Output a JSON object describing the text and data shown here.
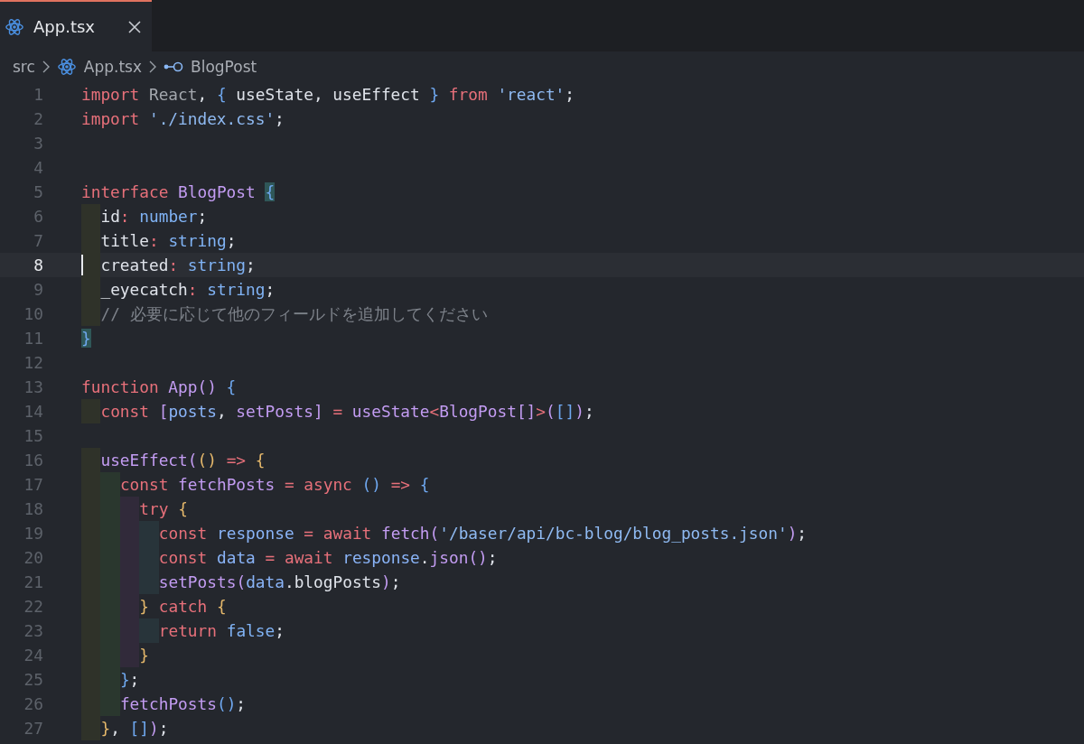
{
  "tabs": [
    {
      "label": "App.tsx",
      "selected": true
    }
  ],
  "breadcrumb": [
    {
      "kind": "folder",
      "label": "src"
    },
    {
      "kind": "file",
      "label": "App.tsx"
    },
    {
      "kind": "symbol",
      "label": "BlogPost"
    }
  ],
  "lines": [
    {
      "number": "1",
      "current": false,
      "tokens": [
        {
          "kind": "kw",
          "text": "import "
        },
        {
          "kind": "dim",
          "text": "React"
        },
        {
          "kind": "id",
          "text": ", "
        },
        {
          "kind": "b1",
          "text": "{ "
        },
        {
          "kind": "id",
          "text": "useState, useEffect "
        },
        {
          "kind": "b1",
          "text": "} "
        },
        {
          "kind": "kw",
          "text": "from "
        },
        {
          "kind": "str",
          "text": "'react'"
        },
        {
          "kind": "id",
          "text": ";"
        }
      ]
    },
    {
      "number": "2",
      "current": false,
      "tokens": [
        {
          "kind": "kw",
          "text": "import "
        },
        {
          "kind": "str",
          "text": "'./index.css'"
        },
        {
          "kind": "id",
          "text": ";"
        }
      ]
    },
    {
      "number": "3",
      "current": false
    },
    {
      "number": "4",
      "current": false
    },
    {
      "number": "5",
      "current": false,
      "tokens": [
        {
          "kind": "kw",
          "text": "interface "
        },
        {
          "kind": "cls",
          "text": "BlogPost "
        },
        {
          "kind": "bm",
          "text": "{"
        }
      ],
      "children": [
        {
          "number": "6",
          "current": false,
          "tokens": [
            {
              "kind": "id",
              "text": "id"
            },
            {
              "kind": "op",
              "text": ": "
            },
            {
              "kind": "typ",
              "text": "number"
            },
            {
              "kind": "id",
              "text": ";"
            }
          ]
        },
        {
          "number": "7",
          "current": false,
          "tokens": [
            {
              "kind": "id",
              "text": "title"
            },
            {
              "kind": "op",
              "text": ": "
            },
            {
              "kind": "typ",
              "text": "string"
            },
            {
              "kind": "id",
              "text": ";"
            }
          ]
        },
        {
          "number": "8",
          "current": true,
          "tokens": [
            {
              "kind": "id",
              "text": "created"
            },
            {
              "kind": "op",
              "text": ": "
            },
            {
              "kind": "typ",
              "text": "string"
            },
            {
              "kind": "id",
              "text": ";"
            }
          ]
        },
        {
          "number": "9",
          "current": false,
          "tokens": [
            {
              "kind": "id",
              "text": "_eyecatch"
            },
            {
              "kind": "op",
              "text": ": "
            },
            {
              "kind": "typ",
              "text": "string"
            },
            {
              "kind": "id",
              "text": ";"
            }
          ]
        },
        {
          "number": "10",
          "current": false,
          "tokens": [
            {
              "kind": "cmt",
              "text": "// 必要に応じて他のフィールドを追加してください"
            }
          ]
        }
      ]
    },
    {
      "number": "11",
      "current": false,
      "tokens": [
        {
          "kind": "bm",
          "text": "}"
        }
      ]
    },
    {
      "number": "12",
      "current": false
    },
    {
      "number": "13",
      "current": false,
      "tokens": [
        {
          "kind": "kw",
          "text": "function "
        },
        {
          "kind": "cls",
          "text": "App"
        },
        {
          "kind": "b3",
          "text": "() "
        },
        {
          "kind": "b1",
          "text": "{"
        }
      ],
      "children": [
        {
          "number": "14",
          "current": false,
          "tokens": [
            {
              "kind": "kw",
              "text": "const "
            },
            {
              "kind": "b3",
              "text": "["
            },
            {
              "kind": "var",
              "text": "posts"
            },
            {
              "kind": "id",
              "text": ", "
            },
            {
              "kind": "cls",
              "text": "setPosts"
            },
            {
              "kind": "b3",
              "text": "] "
            },
            {
              "kind": "op",
              "text": "= "
            },
            {
              "kind": "cls",
              "text": "useState"
            },
            {
              "kind": "op",
              "text": "<"
            },
            {
              "kind": "cls",
              "text": "BlogPost"
            },
            {
              "kind": "b3",
              "text": "[]"
            },
            {
              "kind": "op",
              "text": ">"
            },
            {
              "kind": "b3",
              "text": "("
            },
            {
              "kind": "b1",
              "text": "[]"
            },
            {
              "kind": "b3",
              "text": ")"
            },
            {
              "kind": "id",
              "text": ";"
            }
          ]
        },
        {
          "number": "15",
          "current": false
        },
        {
          "number": "16",
          "current": false,
          "tokens": [
            {
              "kind": "cls",
              "text": "useEffect"
            },
            {
              "kind": "b3",
              "text": "("
            },
            {
              "kind": "b2",
              "text": "() "
            },
            {
              "kind": "op",
              "text": "=> "
            },
            {
              "kind": "b2",
              "text": "{"
            }
          ],
          "children": [
            {
              "number": "17",
              "current": false,
              "tokens": [
                {
                  "kind": "kw",
                  "text": "const "
                },
                {
                  "kind": "cls",
                  "text": "fetchPosts "
                },
                {
                  "kind": "op",
                  "text": "= "
                },
                {
                  "kind": "kw",
                  "text": "async "
                },
                {
                  "kind": "b1",
                  "text": "() "
                },
                {
                  "kind": "op",
                  "text": "=> "
                },
                {
                  "kind": "b1",
                  "text": "{"
                }
              ],
              "children": [
                {
                  "number": "18",
                  "current": false,
                  "tokens": [
                    {
                      "kind": "kw",
                      "text": "try "
                    },
                    {
                      "kind": "b2",
                      "text": "{"
                    }
                  ],
                  "children": [
                    {
                      "number": "19",
                      "current": false,
                      "tokens": [
                        {
                          "kind": "kw",
                          "text": "const "
                        },
                        {
                          "kind": "var",
                          "text": "response "
                        },
                        {
                          "kind": "op",
                          "text": "= "
                        },
                        {
                          "kind": "kw",
                          "text": "await "
                        },
                        {
                          "kind": "cls",
                          "text": "fetch"
                        },
                        {
                          "kind": "b3",
                          "text": "("
                        },
                        {
                          "kind": "str",
                          "text": "'/baser/api/bc-blog/blog_posts.json'"
                        },
                        {
                          "kind": "b3",
                          "text": ")"
                        },
                        {
                          "kind": "id",
                          "text": ";"
                        }
                      ]
                    },
                    {
                      "number": "20",
                      "current": false,
                      "tokens": [
                        {
                          "kind": "kw",
                          "text": "const "
                        },
                        {
                          "kind": "var",
                          "text": "data "
                        },
                        {
                          "kind": "op",
                          "text": "= "
                        },
                        {
                          "kind": "kw",
                          "text": "await "
                        },
                        {
                          "kind": "var",
                          "text": "response"
                        },
                        {
                          "kind": "id",
                          "text": "."
                        },
                        {
                          "kind": "cls",
                          "text": "json"
                        },
                        {
                          "kind": "b3",
                          "text": "()"
                        },
                        {
                          "kind": "id",
                          "text": ";"
                        }
                      ]
                    },
                    {
                      "number": "21",
                      "current": false,
                      "tokens": [
                        {
                          "kind": "cls",
                          "text": "setPosts"
                        },
                        {
                          "kind": "b3",
                          "text": "("
                        },
                        {
                          "kind": "var",
                          "text": "data"
                        },
                        {
                          "kind": "id",
                          "text": ".blogPosts"
                        },
                        {
                          "kind": "b3",
                          "text": ")"
                        },
                        {
                          "kind": "id",
                          "text": ";"
                        }
                      ]
                    }
                  ]
                },
                {
                  "number": "22",
                  "current": false,
                  "tokens": [
                    {
                      "kind": "b2",
                      "text": "} "
                    },
                    {
                      "kind": "kw",
                      "text": "catch "
                    },
                    {
                      "kind": "b2",
                      "text": "{"
                    }
                  ],
                  "children": [
                    {
                      "number": "23",
                      "current": false,
                      "tokens": [
                        {
                          "kind": "kw",
                          "text": "return "
                        },
                        {
                          "kind": "typ",
                          "text": "false"
                        },
                        {
                          "kind": "id",
                          "text": ";"
                        }
                      ]
                    }
                  ]
                },
                {
                  "number": "24",
                  "current": false,
                  "tokens": [
                    {
                      "kind": "b2",
                      "text": "}"
                    }
                  ]
                }
              ]
            },
            {
              "number": "25",
              "current": false,
              "tokens": [
                {
                  "kind": "b1",
                  "text": "}"
                },
                {
                  "kind": "id",
                  "text": ";"
                }
              ]
            },
            {
              "number": "26",
              "current": false,
              "tokens": [
                {
                  "kind": "cls",
                  "text": "fetchPosts"
                },
                {
                  "kind": "b1",
                  "text": "()"
                },
                {
                  "kind": "id",
                  "text": ";"
                }
              ]
            }
          ]
        },
        {
          "number": "27",
          "current": false,
          "tokens": [
            {
              "kind": "b2",
              "text": "}"
            },
            {
              "kind": "id",
              "text": ", "
            },
            {
              "kind": "b1",
              "text": "[]"
            },
            {
              "kind": "b3",
              "text": ")"
            },
            {
              "kind": "id",
              "text": ";"
            }
          ]
        }
      ]
    }
  ]
}
